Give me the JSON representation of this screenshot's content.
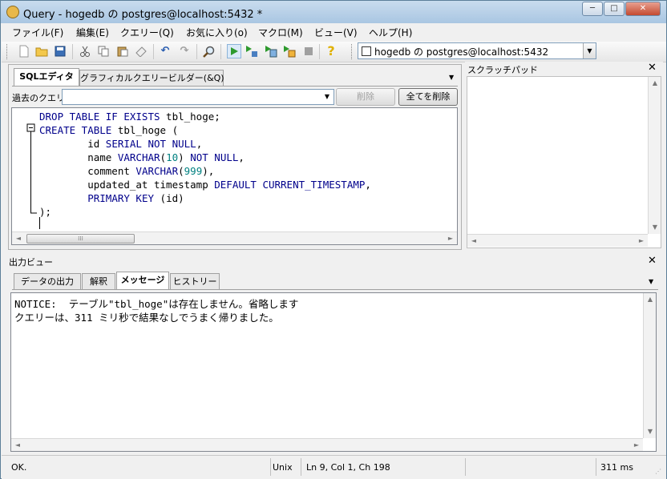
{
  "window": {
    "title": "Query - hogedb の postgres@localhost:5432 *",
    "controls": {
      "minimize": "─",
      "maximize": "□",
      "close": "✕"
    }
  },
  "menu": [
    "ファイル(F)",
    "編集(E)",
    "クエリー(Q)",
    "お気に入り(o)",
    "マクロ(M)",
    "ビュー(V)",
    "ヘルプ(H)"
  ],
  "toolbar": {
    "icons": [
      "new-icon",
      "open-icon",
      "save-icon",
      "cut-icon",
      "copy-icon",
      "paste-icon",
      "clear-icon",
      "undo-icon",
      "redo-icon",
      "find-icon",
      "execute-icon",
      "explain-icon",
      "execute-file-icon",
      "execute-pgscript-icon",
      "cancel-icon",
      "help-icon"
    ],
    "connection": "hogedb の postgres@localhost:5432"
  },
  "editor_pane": {
    "tabs": [
      "SQLエディタ",
      "グラフィカルクエリービルダー(&Q)"
    ],
    "active_tab": "SQLエディタ",
    "history_label": "過去のクエリ",
    "history_value": "",
    "delete_button": "削除",
    "delete_all_button": "全てを削除",
    "code": [
      "DROP TABLE IF EXISTS tbl_hoge;",
      "CREATE TABLE tbl_hoge (",
      "        id SERIAL NOT NULL,",
      "        name VARCHAR(10) NOT NULL,",
      "        comment VARCHAR(999),",
      "        updated_at timestamp DEFAULT CURRENT_TIMESTAMP,",
      "        PRIMARY KEY (id)",
      ");"
    ]
  },
  "scratchpad": {
    "title": "スクラッチパッド"
  },
  "output_pane": {
    "title": "出力ビュー",
    "tabs": [
      "データの出力",
      "解釈",
      "メッセージ",
      "ヒストリー"
    ],
    "active_tab": "メッセージ",
    "messages": [
      "NOTICE:  テーブル\"tbl_hoge\"は存在しません。省略します",
      "クエリーは、311 ミリ秒で結果なしでうまく帰りました。"
    ]
  },
  "status": {
    "message": "OK.",
    "line_ending": "Unix",
    "position": "Ln 9, Col 1, Ch 198",
    "duration": "311 ms"
  }
}
